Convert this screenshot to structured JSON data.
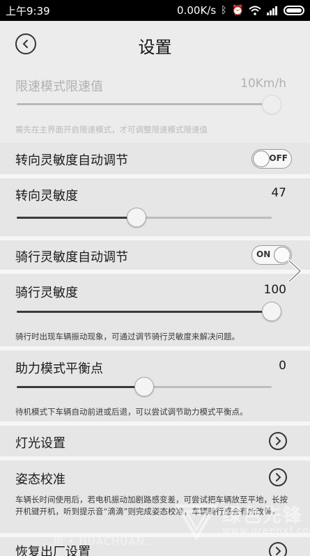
{
  "status_bar": {
    "time": "上午9:39",
    "speed": "0.00K/s",
    "icons": [
      "bluetooth-icon",
      "alarm-icon",
      "wifi-icon",
      "signal-icon",
      "battery-icon"
    ]
  },
  "header": {
    "title": "设置"
  },
  "speed_limit": {
    "label": "限速模式限速值",
    "value": "10Km/h",
    "slider_level": 1.0,
    "hint": "需先在主界面开启限速模式，才可调整限速模式限速值"
  },
  "turn_auto": {
    "label": "转向灵敏度自动调节",
    "toggle_text": "OFF",
    "on": false
  },
  "turn_sensitivity": {
    "label": "转向灵敏度",
    "value": "47",
    "slider_level": 0.47
  },
  "ride_auto": {
    "label": "骑行灵敏度自动调节",
    "toggle_text": "ON",
    "on": true
  },
  "ride_sensitivity": {
    "label": "骑行灵敏度",
    "value": "100",
    "slider_level": 1.0,
    "hint": "骑行时出现车辆振动现象，可通过调节骑行灵敏度来解决问题。"
  },
  "balance": {
    "label": "助力模式平衡点",
    "value": "0",
    "slider_level": 0.5,
    "hint": "待机模式下车辆自动前进或后退，可以尝试调节助力模式平衡点。"
  },
  "light": {
    "label": "灯光设置"
  },
  "posture": {
    "label": "姿态校准",
    "hint": "车辆长时间使用后，若电机振动加剧路感变差，可尝试把车辆放至平地，长按开机键开机，听到提示音“滴滴”则完成姿态校准，车辆骑行感会有所改善。"
  },
  "factory_reset": {
    "label": "恢复出厂设置"
  },
  "watermark": {
    "text": "…用 • HUACHUAN…",
    "brand_cn": "绿色先锋",
    "brand_url": "www.greenxf.com"
  },
  "colors": {
    "background": "#ececec",
    "status_bar": "#000000"
  }
}
